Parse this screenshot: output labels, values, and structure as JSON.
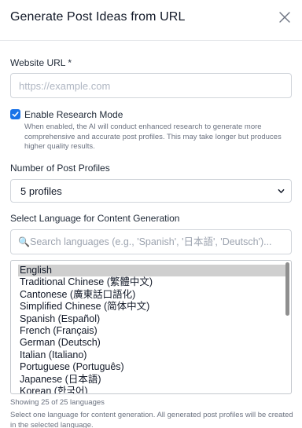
{
  "dialog": {
    "title": "Generate Post Ideas from URL"
  },
  "website": {
    "label": "Website URL *",
    "placeholder": "https://example.com",
    "value": ""
  },
  "research": {
    "checked": true,
    "label": "Enable Research Mode",
    "help": "When enabled, the AI will conduct enhanced research to generate more comprehensive and accurate post profiles. This may take longer but produces higher quality results."
  },
  "profiles": {
    "label": "Number of Post Profiles",
    "selected": "5 profiles"
  },
  "language": {
    "label": "Select Language for Content Generation",
    "search_placeholder": "Search languages (e.g., 'Spanish', '日本語', 'Deutsch')...",
    "selected": "English",
    "options": [
      "English",
      "Traditional Chinese (繁體中文)",
      "Cantonese (廣東話口語化)",
      "Simplified Chinese (简体中文)",
      "Spanish (Español)",
      "French (Français)",
      "German (Deutsch)",
      "Italian (Italiano)",
      "Portuguese (Português)",
      "Japanese (日本語)",
      "Korean (한국어)"
    ],
    "count_text": "Showing 25 of 25 languages",
    "note": "Select one language for content generation. All generated post profiles will be created in the selected language."
  },
  "icons": {
    "close": "close-icon",
    "checkbox": "checkmark-icon",
    "chevron": "chevron-down-icon",
    "search": "magnifier-icon"
  },
  "colors": {
    "accent": "#1a73e8",
    "border": "#d1d5db",
    "muted_text": "#6b7280",
    "selected_option": "#cfcfcf"
  }
}
